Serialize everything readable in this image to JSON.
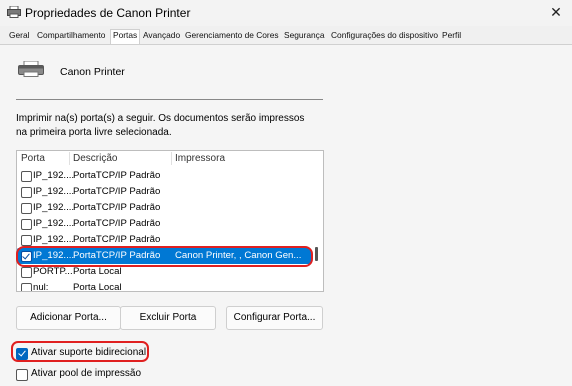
{
  "window": {
    "title": "Propriedades de Canon Printer",
    "close_icon": "close-icon"
  },
  "tabs": [
    "Geral",
    "Compartilhamento",
    "Portas",
    "Avançado",
    "Gerenciamento de Cores",
    "Segurança",
    "Configurações do dispositivo",
    "Perfil"
  ],
  "active_tab": "Portas",
  "printer": {
    "name": "Canon Printer",
    "icon": "printer-icon"
  },
  "description": "Imprimir na(s) porta(s) a seguir. Os documentos serão impressos na primeira porta livre selecionada.",
  "port_list": {
    "columns": [
      "Porta",
      "Descrição",
      "Impressora"
    ],
    "rows": [
      {
        "port": "IP_192....",
        "description": "PortaTCP/IP Padrão",
        "printer": "",
        "checked": false,
        "selected": false
      },
      {
        "port": "IP_192....",
        "description": "PortaTCP/IP Padrão",
        "printer": "",
        "checked": false,
        "selected": false
      },
      {
        "port": "IP_192....",
        "description": "PortaTCP/IP Padrão",
        "printer": "",
        "checked": false,
        "selected": false
      },
      {
        "port": "IP_192....",
        "description": "PortaTCP/IP Padrão",
        "printer": "",
        "checked": false,
        "selected": false
      },
      {
        "port": "IP_192....",
        "description": "PortaTCP/IP Padrão",
        "printer": "",
        "checked": false,
        "selected": false
      },
      {
        "port": "IP_192....",
        "description": "PortaTCP/IP Padrão",
        "printer": "Canon Printer,    , Canon Gen...",
        "checked": true,
        "selected": true
      },
      {
        "port": "PORTP...",
        "description": "Porta Local",
        "printer": "",
        "checked": false,
        "selected": false
      },
      {
        "port": "nul:",
        "description": "Porta Local",
        "printer": "",
        "checked": false,
        "selected": false
      }
    ]
  },
  "buttons": {
    "add_port": "Adicionar Porta...",
    "delete_port": "Excluir Porta",
    "configure_port": "Configurar Porta..."
  },
  "options": {
    "bidirectional": {
      "label": "Ativar suporte bidirecional",
      "checked": true
    },
    "pooling": {
      "label": "Ativar pool de impressão",
      "checked": false
    }
  },
  "colors": {
    "selection": "#0078d4",
    "highlight": "#e02020",
    "checkbox_on": "#0067c0"
  }
}
